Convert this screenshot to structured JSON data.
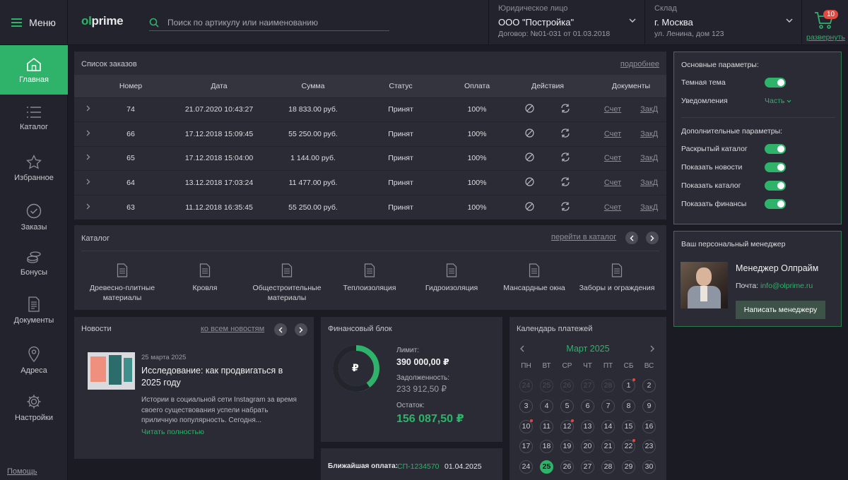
{
  "header": {
    "menu_label": "Меню",
    "logo_prefix": "ol",
    "logo_text": "prime",
    "search_placeholder": "Поиск по артикулу или наименованию",
    "legal": {
      "caption": "Юридическое лицо",
      "value": "ООО \"Постройка\"",
      "sub": "Договор: №01-031 от 01.03.2018"
    },
    "warehouse": {
      "caption": "Склад",
      "value": "г. Москва",
      "sub": "ул. Ленина, дом 123"
    },
    "cart": {
      "count": "10",
      "expand_label": "развернуть"
    }
  },
  "sidebar": {
    "items": [
      {
        "label": "Главная",
        "icon": "home-icon"
      },
      {
        "label": "Каталог",
        "icon": "list-icon"
      },
      {
        "label": "Избранное",
        "icon": "star-icon"
      },
      {
        "label": "Заказы",
        "icon": "check-circle-icon"
      },
      {
        "label": "Бонусы",
        "icon": "coins-icon"
      },
      {
        "label": "Документы",
        "icon": "document-icon"
      },
      {
        "label": "Адреса",
        "icon": "map-pin-icon"
      },
      {
        "label": "Настройки",
        "icon": "gear-icon"
      }
    ],
    "help_label": "Помощь"
  },
  "orders": {
    "title": "Список заказов",
    "more_label": "подробнее",
    "columns": [
      "Номер",
      "Дата",
      "Сумма",
      "Статус",
      "Оплата",
      "Действия",
      "Документы"
    ],
    "rows": [
      {
        "number": "74",
        "date": "21.07.2020 10:43:27",
        "sum": "18 833.00 руб.",
        "status": "Принят",
        "payment": "100%",
        "doc1": "Счет",
        "doc2": "ЗакД"
      },
      {
        "number": "66",
        "date": "17.12.2018 15:09:45",
        "sum": "55 250.00 руб.",
        "status": "Принят",
        "payment": "100%",
        "doc1": "Счет",
        "doc2": "ЗакД"
      },
      {
        "number": "65",
        "date": "17.12.2018 15:04:00",
        "sum": "1 144.00 руб.",
        "status": "Принят",
        "payment": "100%",
        "doc1": "Счет",
        "doc2": "ЗакД"
      },
      {
        "number": "64",
        "date": "13.12.2018 17:03:24",
        "sum": "11 477.00 руб.",
        "status": "Принят",
        "payment": "100%",
        "doc1": "Счет",
        "doc2": "ЗакД"
      },
      {
        "number": "63",
        "date": "11.12.2018 16:35:45",
        "sum": "55 250.00 руб.",
        "status": "Принят",
        "payment": "100%",
        "doc1": "Счет",
        "doc2": "ЗакД"
      }
    ]
  },
  "catalog": {
    "title": "Каталог",
    "link_label": "перейти в каталог",
    "items": [
      "Древесно-плитные материалы",
      "Кровля",
      "Общестроительные материалы",
      "Теплоизоляция",
      "Гидроизоляция",
      "Мансардные окна",
      "Заборы и ограждения"
    ]
  },
  "news": {
    "title": "Новости",
    "link_label": "ко всем новостям",
    "date": "25 марта 2025",
    "headline": "Исследование: как продвигаться в 2025 году",
    "text": "Истории в социальной сети Instagram за время своего существования успели набрать приличную популярность. Сегодня...",
    "read_more": "Читать полностью"
  },
  "finance": {
    "title": "Финансовый блок",
    "currency_symbol": "₽",
    "limit_label": "Лимит:",
    "limit_value": "390 000,00 ₽",
    "debt_label": "Задолженность:",
    "debt_value": "233 912,50 ₽",
    "rest_label": "Остаток:",
    "rest_value": "156 087,50 ₽",
    "rest_share": 0.4
  },
  "nearest_payment": {
    "label": "Ближайшая оплата:",
    "code": "СП-1234570",
    "date": "01.04.2025"
  },
  "calendar": {
    "title": "Календарь платежей",
    "month": "Март 2025",
    "weekdays": [
      "ПН",
      "ВТ",
      "СР",
      "ЧТ",
      "ПТ",
      "СБ",
      "ВС"
    ],
    "prev_days": [
      "24",
      "25",
      "26",
      "27",
      "28"
    ],
    "days": [
      "1",
      "2",
      "3",
      "4",
      "5",
      "6",
      "7",
      "8",
      "9",
      "10",
      "11",
      "12",
      "13",
      "14",
      "15",
      "16",
      "17",
      "18",
      "19",
      "20",
      "21",
      "22",
      "23",
      "24",
      "25",
      "26",
      "27",
      "28",
      "29",
      "30"
    ],
    "today": "25",
    "marked_days": [
      "1",
      "10",
      "12",
      "22"
    ]
  },
  "settings": {
    "main_title": "Основные параметры:",
    "dark_theme_label": "Темная тема",
    "notifications_label": "Уведомления",
    "notifications_value": "Часть",
    "extra_title": "Дополнительные параметры:",
    "extra_items": [
      "Раскрытый каталог",
      "Показать новости",
      "Показать каталог",
      "Показать финансы"
    ]
  },
  "manager": {
    "title": "Ваш персональный менеджер",
    "name": "Менеджер Олпрайм",
    "email_label": "Почта:",
    "email": "info@olprime.ru",
    "button_label": "Написать менеджеру"
  },
  "colors": {
    "accent": "#2fb36a",
    "bg": "#1b1c23",
    "panel": "#2a2b34",
    "alert": "#e5483f"
  }
}
